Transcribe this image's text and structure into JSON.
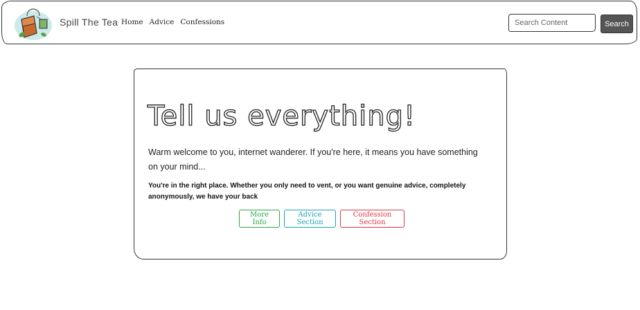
{
  "navbar": {
    "brand": "Spill The Tea",
    "links": [
      "Home",
      "Advice",
      "Confessions"
    ],
    "search_placeholder": "Search Content",
    "search_button": "Search"
  },
  "hero": {
    "title": "Tell us everything!",
    "lead": "Warm welcome to you, internet wanderer. If you're here, it means you have something on your mind...",
    "sub": "You're in the right place. Whether you only need to vent, or you want genuine advice, completely anonymously, we have your back",
    "buttons": [
      "More Info",
      "Advice Section",
      "Confession Section"
    ]
  },
  "colors": {
    "success": "#28a745",
    "info": "#17a2b8",
    "danger": "#dc3545",
    "search_button_bg": "#555555"
  },
  "icons": {
    "logo": "tea-bag-icon"
  }
}
